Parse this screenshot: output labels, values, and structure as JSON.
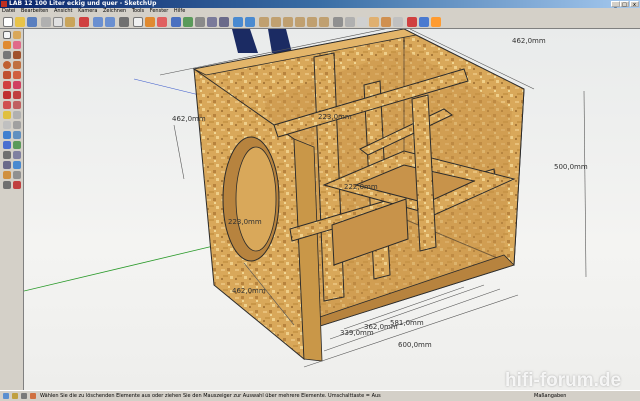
{
  "window": {
    "title": "LAB 12 100 Liter eckig und quer - SketchUp",
    "minimize_label": "_",
    "maximize_label": "□",
    "close_label": "x"
  },
  "menu": [
    "Datei",
    "Bearbeiten",
    "Ansicht",
    "Kamera",
    "Zeichnen",
    "Tools",
    "Fenster",
    "Hilfe"
  ],
  "dimensions": {
    "top_depth": "462,0mm",
    "height": "500,0mm",
    "left_depth": "462,0mm",
    "front_depth": "462,0mm",
    "inner_a": "223,0mm",
    "inner_b": "223,0mm",
    "inner_c": "222,0mm",
    "inner_d": "362,0mm",
    "inner_e": "581,0mm",
    "inner_f": "339,0mm",
    "width": "600,0mm"
  },
  "status": {
    "message": "Wählen Sie die zu löschenden Elemente aus oder ziehen Sie den Mauszeiger zur Auswahl über mehrere Elemente. Umschalttaste = Aus",
    "measurements_label": "Maßangaben"
  },
  "watermark": "hifi-forum.de",
  "colors": {
    "wood": "#d9a85a",
    "wood_dark": "#b7833e",
    "edge": "#2b2b2b",
    "background_post": "#1b2b63"
  }
}
